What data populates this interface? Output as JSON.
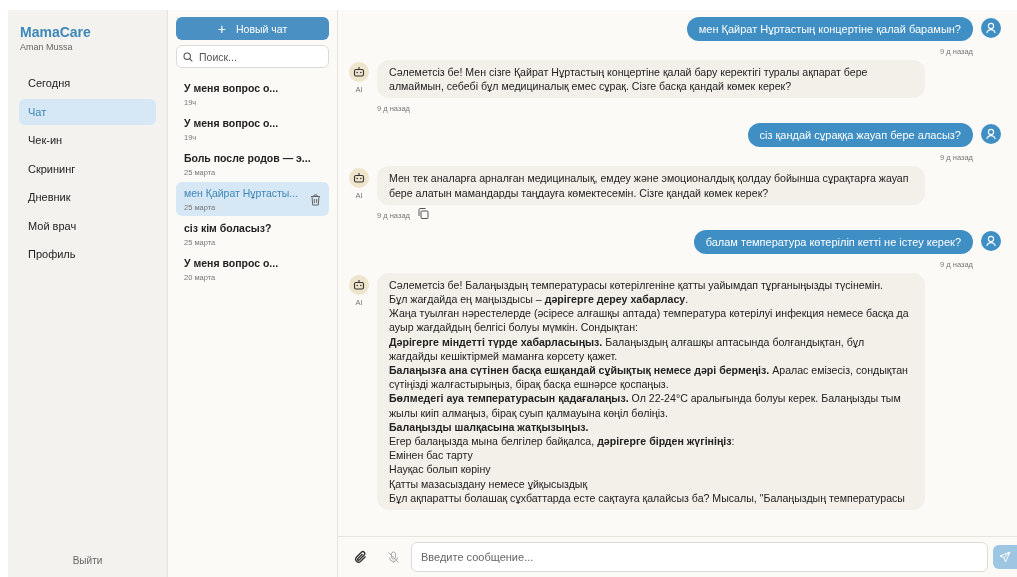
{
  "brand": {
    "title": "MamaCare",
    "user": "Aman Mussa"
  },
  "nav": [
    {
      "label": "Сегодня",
      "selected": false
    },
    {
      "label": "Чат",
      "selected": true
    },
    {
      "label": "Чек-ин",
      "selected": false
    },
    {
      "label": "Скрининг",
      "selected": false
    },
    {
      "label": "Дневник",
      "selected": false
    },
    {
      "label": "Мой врач",
      "selected": false
    },
    {
      "label": "Профиль",
      "selected": false
    }
  ],
  "logout": "Выйти",
  "new_chat": {
    "icon": "+",
    "label": "Новый чат"
  },
  "search": {
    "placeholder": "Поиск..."
  },
  "chats": [
    {
      "title": "У меня вопрос о...",
      "time": "19ч",
      "selected": false
    },
    {
      "title": "У меня вопрос о...",
      "time": "19ч",
      "selected": false
    },
    {
      "title": "Боль после родов — э...",
      "time": "25 марта",
      "selected": false
    },
    {
      "title": "мен Қайрат Нұртасты...",
      "time": "25 марта",
      "selected": true
    },
    {
      "title": "сіз кім боласыз?",
      "time": "25 марта",
      "selected": false
    },
    {
      "title": "У меня вопрос о...",
      "time": "20 марта",
      "selected": false
    }
  ],
  "messages": [
    {
      "kind": "user",
      "lines": [
        "мен Қайрат Нұртастың концертіне қалай барамын?"
      ],
      "time": "9 д назад",
      "copy_button": false
    },
    {
      "kind": "ai",
      "label": "AI",
      "lines": [
        "Сәлеметсіз бе! Мен сізге Қайрат Нұртастың концертіне қалай бару керектігі туралы ақпарат бере алмаймын, себебі бұл медициналық емес сұрақ. Сізге басқа қандай көмек керек?"
      ],
      "time": "9 д назад",
      "copy_button": false
    },
    {
      "kind": "user",
      "lines": [
        "сіз қандай сұраққа жауап бере аласыз?"
      ],
      "time": "9 д назад",
      "copy_button": false
    },
    {
      "kind": "ai",
      "label": "AI",
      "lines": [
        "Мен тек аналарға арналған медициналық, емдеу және эмоционалдық қолдау бойынша сұрақтарға жауап бере алатын мамандарды таңдауға көмектесемін. Сізге қандай көмек керек?"
      ],
      "time": "9 д назад",
      "copy_button": true
    },
    {
      "kind": "user",
      "lines": [
        "балам температура көтеріліп кетті не істеу керек?"
      ],
      "time": "9 д назад",
      "copy_button": false
    },
    {
      "kind": "ai",
      "label": "AI",
      "lines": [
        "Сәлеметсіз бе! Балаңыздың температурасы көтерілгеніне қатты уайымдап тұрғаныңызды түсінемін.",
        "Бұл жағдайда ең маңыздысы – **дәрігерге дереу хабарласу**.",
        "Жаңа туылған нәрестелерде (әсіресе алғашқы аптада) температура көтерілуі инфекция немесе басқа да ауыр жағдайдың белгісі болуы мүмкін. Сондықтан:",
        "**Дәрігерге міндетті түрде хабарласыңыз.** Балаңыздың алғашқы аптасында болғандықтан, бұл жағдайды кешіктірмей маманға көрсету қажет.",
        "**Балаңызға ана сүтінен басқа ешқандай сұйықтық немесе дәрі бермеңіз.** Аралас емізесіз, сондықтан сүтіңізді жалғастырыңыз, бірақ басқа ешнәрсе қоспаңыз.",
        "**Бөлмедегі ауа температурасын қадағалаңыз.** Ол 22-24°C аралығында болуы керек. Балаңызды тым жылы киіп алмаңыз, бірақ суып қалмауына көңіл бөліңіз.",
        "**Балаңызды шалқасына жатқызыңыз.**",
        "Егер балаңызда мына белгілер байқалса, **дәрігерге бірден жүгініңіз**:",
        "Емінен бас тарту",
        "Науқас болып көріну",
        "Қатты мазасыздану немесе ұйқысыздық",
        "Бұл ақпаратты болашақ сұхбаттарда есте сақтауға қалайсыз ба? Мысалы, \"Балаңыздың температурасы"
      ],
      "copy_button": false
    }
  ],
  "composer": {
    "placeholder": "Введите сообщение...",
    "mic_disabled": true
  }
}
